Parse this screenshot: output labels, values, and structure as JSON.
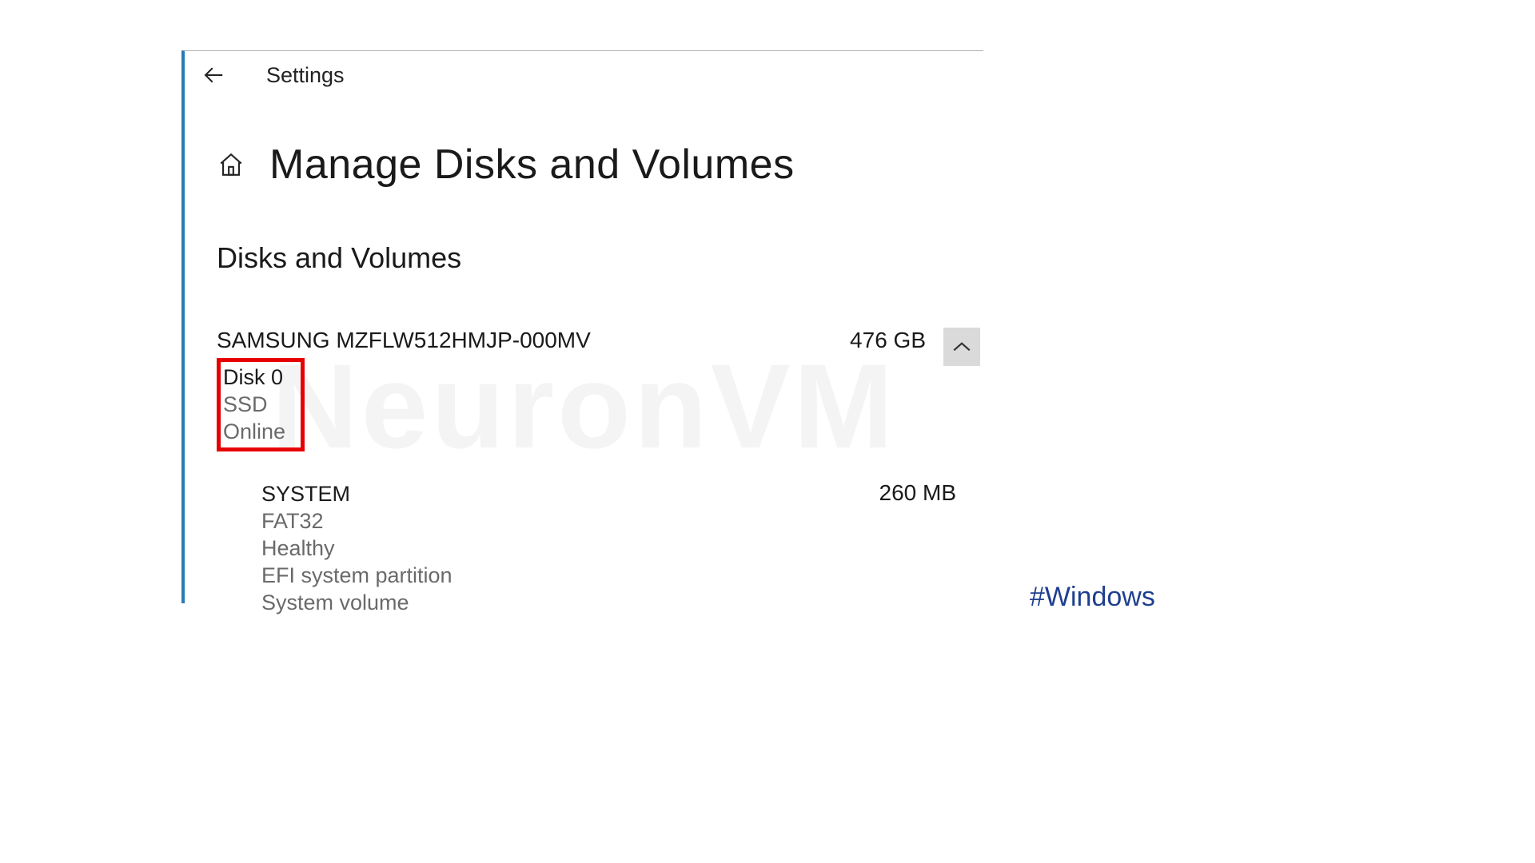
{
  "header": {
    "back_aria": "Back",
    "app_title": "Settings"
  },
  "page": {
    "title": "Manage Disks and Volumes",
    "section_heading": "Disks and Volumes"
  },
  "disk": {
    "name": "SAMSUNG MZFLW512HMJP-000MV",
    "size": "476 GB",
    "index_label": "Disk 0",
    "media_type": "SSD",
    "status": "Online"
  },
  "volume": {
    "name": "SYSTEM",
    "size": "260 MB",
    "fs": "FAT32",
    "health": "Healthy",
    "partition_type": "EFI system partition",
    "role": "System volume"
  },
  "watermark": "NeuronVM",
  "hashtag": "#Windows"
}
